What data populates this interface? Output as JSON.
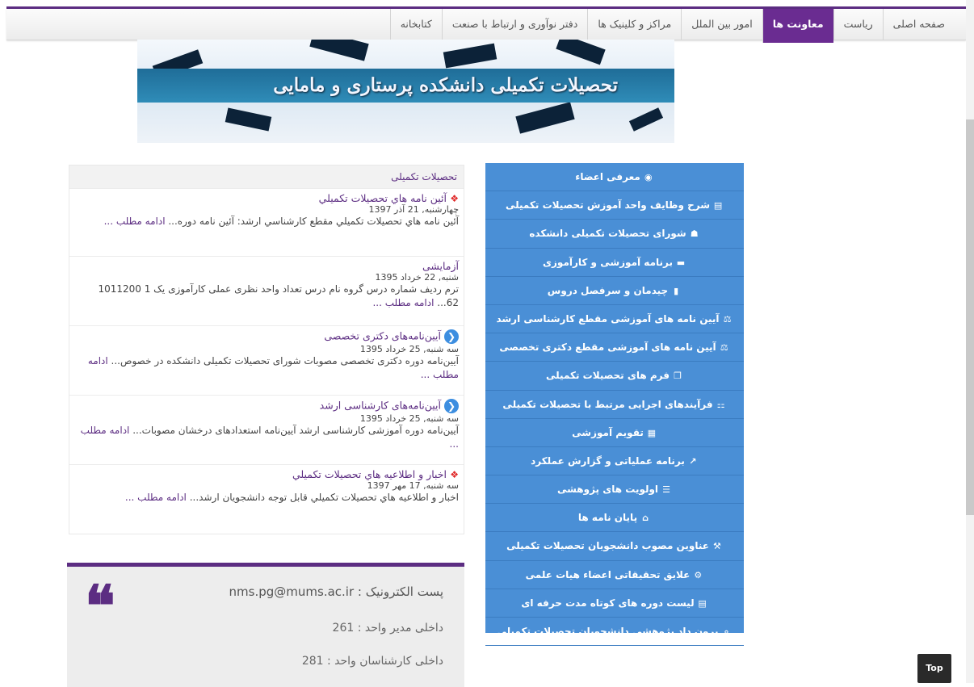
{
  "nav": {
    "items": [
      "صفحه اصلی",
      "ریاست",
      "معاونت ها",
      "امور بین الملل",
      "مراکز و کلینیک ها",
      "دفتر نوآوری و ارتباط با صنعت",
      "کتابخانه"
    ],
    "active_index": 2
  },
  "banner": {
    "title": "تحصیلات تکمیلی دانشکده پرستاری و مامایی"
  },
  "side_menu": [
    {
      "label": "معرفی اعضاء",
      "icon": "user-circle-icon"
    },
    {
      "label": "شرح وظایف واحد آموزش تحصیلات تکمیلی",
      "icon": "list-icon"
    },
    {
      "label": "شورای تحصیلات تکمیلی دانشکده",
      "icon": "users-icon"
    },
    {
      "label": "برنامه آموزشی و کارآموزی",
      "icon": "bed-icon"
    },
    {
      "label": "چیدمان و سرفصل دروس",
      "icon": "book-icon"
    },
    {
      "label": "آیین نامه های آموزشی مقطع کارشناسی ارشد",
      "icon": "balance-scale-icon"
    },
    {
      "label": "آیین نامه های آموزشی مقطع دکتری تخصصی",
      "icon": "balance-scale-icon"
    },
    {
      "label": "فرم های تحصیلات تکمیلی",
      "icon": "copy-icon"
    },
    {
      "label": "فرآیندهای اجرایی مرتبط با تحصیلات تکمیلی",
      "icon": "sitemap-icon"
    },
    {
      "label": "تقویم آموزشی",
      "icon": "calendar-icon"
    },
    {
      "label": "برنامه عملیاتی و گزارش عملکرد",
      "icon": "line-chart-icon"
    },
    {
      "label": "اولویت های پژوهشی",
      "icon": "list-ol-icon"
    },
    {
      "label": "پایان نامه ها",
      "icon": "graduation-cap-icon"
    },
    {
      "label": "عناوین مصوب دانشجویان تحصیلات تکمیلی",
      "icon": "gavel-icon"
    },
    {
      "label": "علایق تحقیقاتی اعضاء هیات علمی",
      "icon": "gears-icon"
    },
    {
      "label": "لیست دوره های کوتاه مدت حرفه ای",
      "icon": "list-alt-icon"
    },
    {
      "label": "برون داد پژوهشی دانشجویان تحصیلات تکمیلی",
      "icon": "search-icon"
    }
  ],
  "news": {
    "header": "تحصیلات تکمیلی",
    "items": [
      {
        "title": "آئين نامه هاي تحصيلات تكميلي",
        "date": "چهارشنبه, 21 آذر 1397",
        "body": "آئين نامه هاي تحصيلات تكميلي      مقطع كارشناسي ارشد:    آئين نامه دوره... ",
        "more": "ادامه مطلب ...",
        "icon": "red-diamond-icon"
      },
      {
        "title": "آزمایشی",
        "date": "شنبه, 22 خرداد 1395",
        "body": "ترم ردیف شماره درس گروه نام درس تعداد واحد     نظری عملی کارآموزی     یک 1 1011200 62... ",
        "more": "ادامه مطلب ...",
        "icon": ""
      },
      {
        "title": "آیین‌نامه‌های دکتری تخصصی",
        "date": "سه شنبه, 25 خرداد 1395",
        "body": "آیین‌نامه دوره دکتری تخصصی    مصوبات شورای تحصیلات تکمیلی دانشکده در خصوص... ",
        "more": "ادامه مطلب ...",
        "icon": "blue-chevron-icon"
      },
      {
        "title": "آیین‌نامه‌های کارشناسی ارشد",
        "date": "سه شنبه, 25 خرداد 1395",
        "body": "آیین‌نامه دوره آموزشی کارشناسی ارشد     آیین‌نامه استعدادهای درخشان    مصوبات... ",
        "more": "ادامه مطلب ...",
        "icon": "blue-chevron-icon"
      },
      {
        "title": "اخبار و اطلاعيه هاي تحصيلات تكميلي",
        "date": "سه شنبه, 17 مهر 1397",
        "body": "اخبار و اطلاعيه هاي تحصيلات تكميلي        قابل توجه دانشجويان ارشد... ",
        "more": "ادامه مطلب ...",
        "icon": "red-diamond-icon"
      }
    ]
  },
  "contact": {
    "email": "پست الکترونیک : nms.pg@mums.ac.ir",
    "manager_ext": "داخلی مدیر واحد : 261",
    "experts_ext": "داخلی کارشناسان واحد : 281"
  },
  "top_button": "Top",
  "colors": {
    "purple": "#5c2d82",
    "menu_blue": "#4a8fd6",
    "nav_active": "#6a2c91"
  }
}
